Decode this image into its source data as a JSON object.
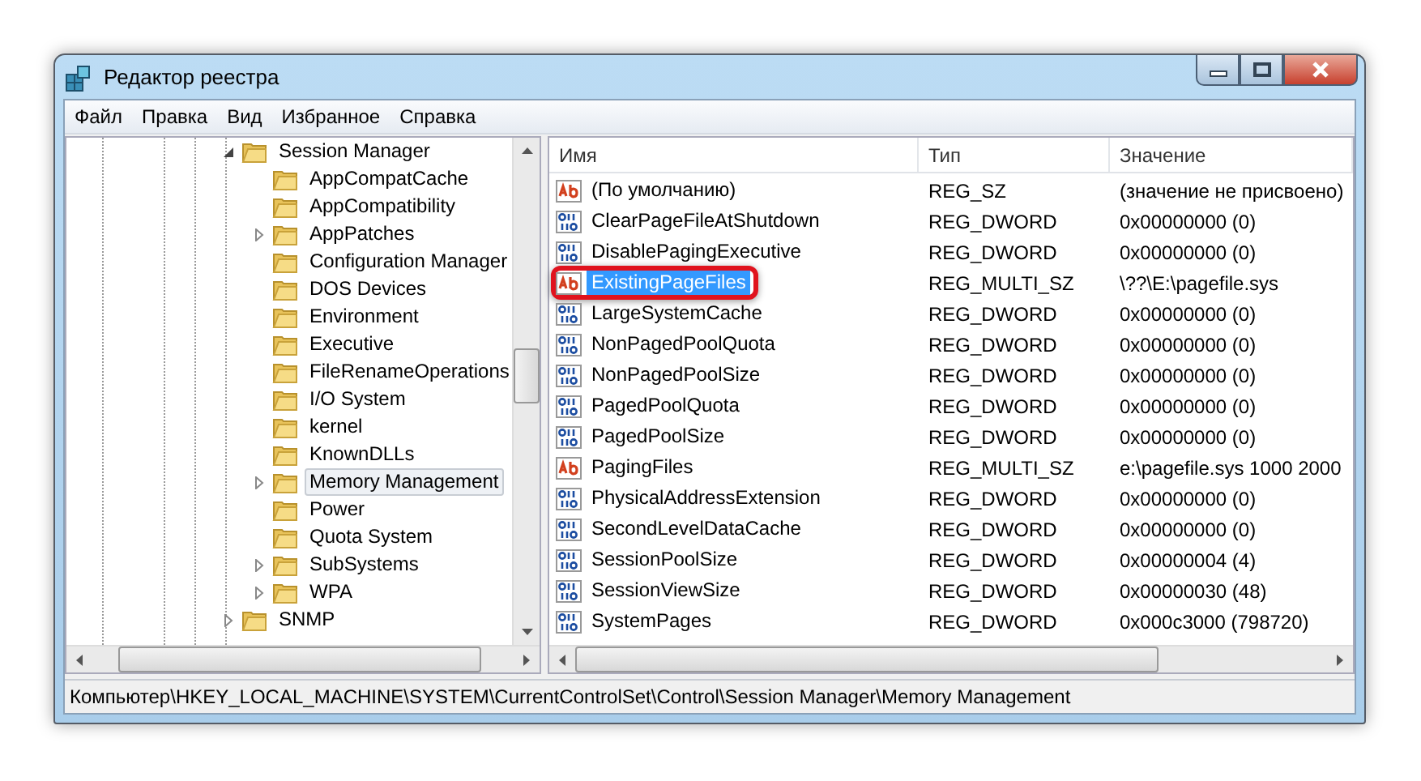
{
  "window": {
    "title": "Редактор реестра"
  },
  "menu": [
    "Файл",
    "Правка",
    "Вид",
    "Избранное",
    "Справка"
  ],
  "tree": [
    {
      "label": "Session Manager",
      "expanded": true,
      "selected": false,
      "children": [
        {
          "label": "AppCompatCache",
          "selected": false
        },
        {
          "label": "AppCompatibility",
          "selected": false
        },
        {
          "label": "AppPatches",
          "expanded": false,
          "selected": false
        },
        {
          "label": "Configuration Manager",
          "selected": false
        },
        {
          "label": "DOS Devices",
          "selected": false
        },
        {
          "label": "Environment",
          "selected": false
        },
        {
          "label": "Executive",
          "selected": false
        },
        {
          "label": "FileRenameOperations",
          "selected": false
        },
        {
          "label": "I/O System",
          "selected": false
        },
        {
          "label": "kernel",
          "selected": false
        },
        {
          "label": "KnownDLLs",
          "selected": false
        },
        {
          "label": "Memory Management",
          "expanded": false,
          "selected": true
        },
        {
          "label": "Power",
          "selected": false
        },
        {
          "label": "Quota System",
          "selected": false
        },
        {
          "label": "SubSystems",
          "expanded": false,
          "selected": false
        },
        {
          "label": "WPA",
          "expanded": false,
          "selected": false
        }
      ]
    },
    {
      "label": "SNMP",
      "expanded": false,
      "selected": false
    }
  ],
  "table": {
    "columns": [
      "Имя",
      "Тип",
      "Значение"
    ],
    "rows": [
      {
        "kind": "string",
        "name": "(По умолчанию)",
        "type": "REG_SZ",
        "value": "(значение не присвоено)",
        "selected": false
      },
      {
        "kind": "dword",
        "name": "ClearPageFileAtShutdown",
        "type": "REG_DWORD",
        "value": "0x00000000 (0)",
        "selected": false
      },
      {
        "kind": "dword",
        "name": "DisablePagingExecutive",
        "type": "REG_DWORD",
        "value": "0x00000000 (0)",
        "selected": false
      },
      {
        "kind": "string",
        "name": "ExistingPageFiles",
        "type": "REG_MULTI_SZ",
        "value": "\\??\\E:\\pagefile.sys",
        "selected": true
      },
      {
        "kind": "dword",
        "name": "LargeSystemCache",
        "type": "REG_DWORD",
        "value": "0x00000000 (0)",
        "selected": false
      },
      {
        "kind": "dword",
        "name": "NonPagedPoolQuota",
        "type": "REG_DWORD",
        "value": "0x00000000 (0)",
        "selected": false
      },
      {
        "kind": "dword",
        "name": "NonPagedPoolSize",
        "type": "REG_DWORD",
        "value": "0x00000000 (0)",
        "selected": false
      },
      {
        "kind": "dword",
        "name": "PagedPoolQuota",
        "type": "REG_DWORD",
        "value": "0x00000000 (0)",
        "selected": false
      },
      {
        "kind": "dword",
        "name": "PagedPoolSize",
        "type": "REG_DWORD",
        "value": "0x00000000 (0)",
        "selected": false
      },
      {
        "kind": "string",
        "name": "PagingFiles",
        "type": "REG_MULTI_SZ",
        "value": "e:\\pagefile.sys 1000 2000",
        "selected": false
      },
      {
        "kind": "dword",
        "name": "PhysicalAddressExtension",
        "type": "REG_DWORD",
        "value": "0x00000000 (0)",
        "selected": false
      },
      {
        "kind": "dword",
        "name": "SecondLevelDataCache",
        "type": "REG_DWORD",
        "value": "0x00000000 (0)",
        "selected": false
      },
      {
        "kind": "dword",
        "name": "SessionPoolSize",
        "type": "REG_DWORD",
        "value": "0x00000004 (4)",
        "selected": false
      },
      {
        "kind": "dword",
        "name": "SessionViewSize",
        "type": "REG_DWORD",
        "value": "0x00000030 (48)",
        "selected": false
      },
      {
        "kind": "dword",
        "name": "SystemPages",
        "type": "REG_DWORD",
        "value": "0x000c3000 (798720)",
        "selected": false
      }
    ]
  },
  "status_bar": "Компьютер\\HKEY_LOCAL_MACHINE\\SYSTEM\\CurrentControlSet\\Control\\Session Manager\\Memory Management"
}
